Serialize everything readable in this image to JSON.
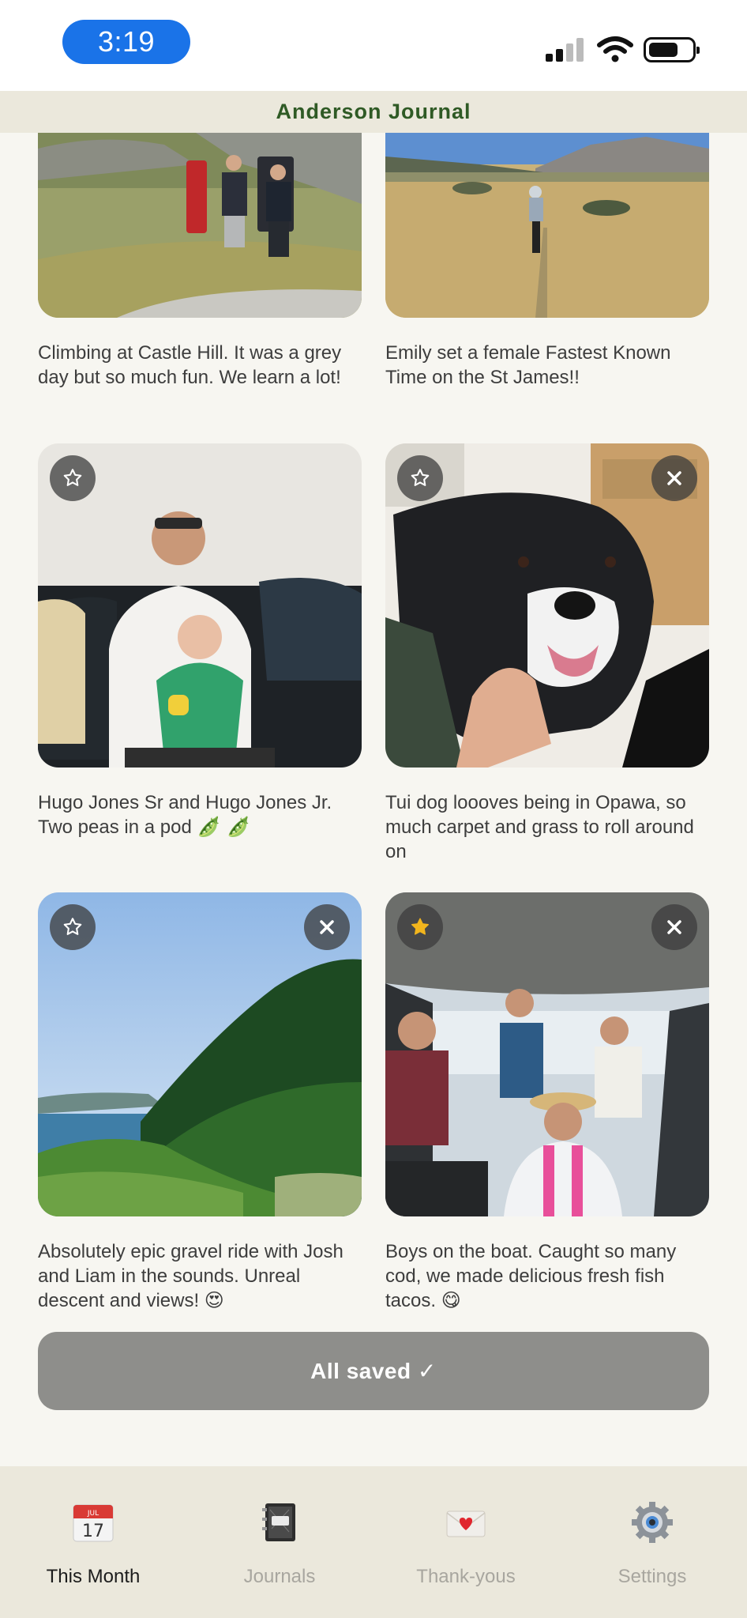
{
  "status_bar": {
    "time": "3:19"
  },
  "header": {
    "title": "Anderson Journal"
  },
  "posts": [
    {
      "caption": "Climbing at Castle Hill. It was a grey day but so much fun. We learn a lot!",
      "emoji": ""
    },
    {
      "caption": "Emily set a female Fastest Known Time on the St James!!",
      "emoji": ""
    },
    {
      "caption": "Hugo Jones Sr and Hugo Jones Jr. Two peas in a pod ",
      "emoji": "🫛 🫛",
      "starred": false,
      "removable": false
    },
    {
      "caption": "Tui dog loooves being in Opawa, so much carpet and grass to roll around on",
      "emoji": "",
      "starred": false,
      "removable": true
    },
    {
      "caption": "Absolutely epic gravel ride with Josh and Liam in the sounds. Unreal descent and views! ",
      "emoji": "😍",
      "starred": false,
      "removable": true
    },
    {
      "caption": "Boys on the boat. Caught so many cod, we made delicious fresh fish tacos. ",
      "emoji": "😋",
      "starred": true,
      "removable": true
    }
  ],
  "save_button": {
    "label": "All saved ✓"
  },
  "tabs": [
    {
      "label": "This Month",
      "active": true,
      "icon": "calendar-icon",
      "icon_month": "JUL",
      "icon_day": "17"
    },
    {
      "label": "Journals",
      "active": false,
      "icon": "notebook-icon"
    },
    {
      "label": "Thank-yous",
      "active": false,
      "icon": "love-letter-icon"
    },
    {
      "label": "Settings",
      "active": false,
      "icon": "gear-icon"
    }
  ],
  "colors": {
    "accent": "#2f5a25",
    "time_pill": "#1a73e8",
    "save_button": "#8e8e8b",
    "star_active": "#f2b51d"
  }
}
